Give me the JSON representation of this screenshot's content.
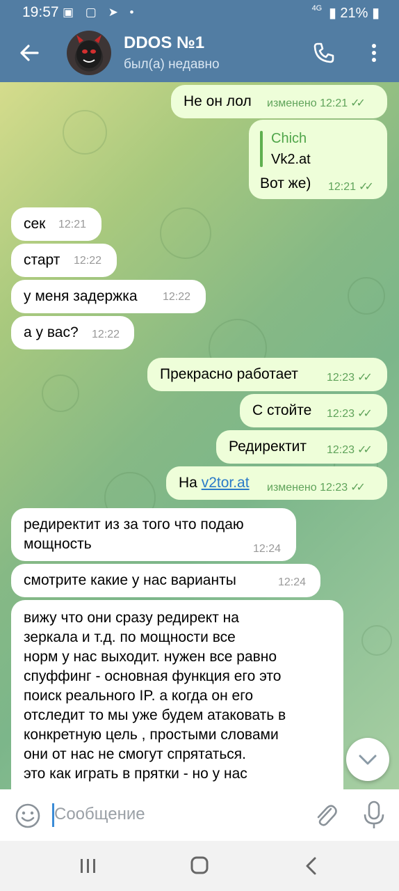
{
  "status": {
    "time": "19:57",
    "network": "4G",
    "battery": "21%"
  },
  "header": {
    "title": "DDOS №1",
    "subtitle": "был(а) недавно"
  },
  "messages": [
    {
      "dir": "out",
      "text": "Не он лол",
      "time": "изменено 12:21"
    },
    {
      "dir": "out",
      "reply_name": "Chich",
      "reply_text": "Vk2.at",
      "text": "Вот же)",
      "time": "12:21"
    },
    {
      "dir": "in",
      "text": "сек",
      "time": "12:21"
    },
    {
      "dir": "in",
      "text": "старт",
      "time": "12:22"
    },
    {
      "dir": "in",
      "text": "у меня задержка",
      "time": "12:22"
    },
    {
      "dir": "in",
      "text": "а у вас?",
      "time": "12:22"
    },
    {
      "dir": "out",
      "text": "Прекрасно работает",
      "time": "12:23"
    },
    {
      "dir": "out",
      "text": "С стойте",
      "time": "12:23"
    },
    {
      "dir": "out",
      "text": "Редиректит",
      "time": "12:23"
    },
    {
      "dir": "out",
      "prefix": "На ",
      "link": "v2tor.at",
      "time": "изменено 12:23"
    },
    {
      "dir": "in",
      "lines": [
        "редиректит из за того что подаю",
        "мощность"
      ],
      "time": "12:24"
    },
    {
      "dir": "in",
      "text": "смотрите какие у нас варианты",
      "time": "12:24"
    },
    {
      "dir": "in",
      "lines": [
        "вижу что они сразу редирект на",
        "зеркала и т.д.  по мощности все",
        "норм у нас выходит. нужен все равно",
        "спуффинг - основная функция его это",
        "поиск реального IP. а когда он его",
        "отследит то мы уже будем атаковать в",
        "конкретную цель , простыми словами",
        "они от нас не смогут спрятаться.",
        "это как играть в прятки - но у нас"
      ]
    }
  ],
  "input": {
    "placeholder": "Сообщение"
  },
  "colors": {
    "header": "#527da3",
    "outgoing": "#eefed9",
    "incoming": "#ffffff",
    "accent": "#5fa35a"
  }
}
